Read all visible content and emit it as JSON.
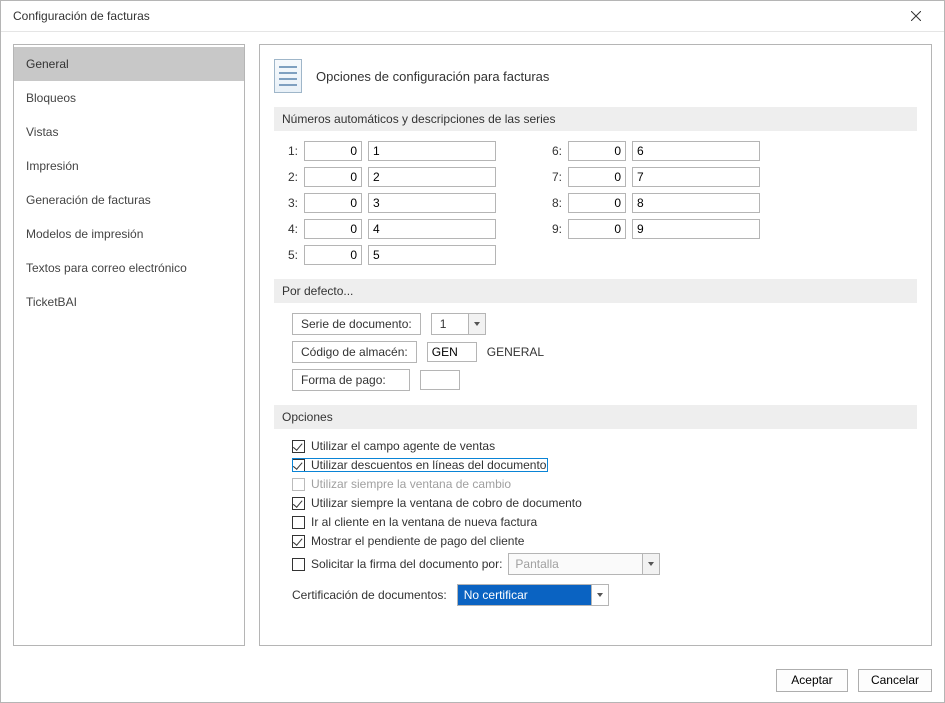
{
  "window": {
    "title": "Configuración de facturas"
  },
  "sidebar": {
    "items": [
      {
        "label": "General",
        "active": true
      },
      {
        "label": "Bloqueos"
      },
      {
        "label": "Vistas"
      },
      {
        "label": "Impresión"
      },
      {
        "label": "Generación de facturas"
      },
      {
        "label": "Modelos de impresión"
      },
      {
        "label": "Textos para correo electrónico"
      },
      {
        "label": "TicketBAI"
      }
    ]
  },
  "header": {
    "title": "Opciones de configuración para facturas"
  },
  "sections": {
    "series_header": "Números automáticos y descripciones de las series",
    "defaults_header": "Por defecto...",
    "options_header": "Opciones"
  },
  "series": [
    {
      "idx": "1:",
      "num": "0",
      "desc": "1"
    },
    {
      "idx": "2:",
      "num": "0",
      "desc": "2"
    },
    {
      "idx": "3:",
      "num": "0",
      "desc": "3"
    },
    {
      "idx": "4:",
      "num": "0",
      "desc": "4"
    },
    {
      "idx": "5:",
      "num": "0",
      "desc": "5"
    },
    {
      "idx": "6:",
      "num": "0",
      "desc": "6"
    },
    {
      "idx": "7:",
      "num": "0",
      "desc": "7"
    },
    {
      "idx": "8:",
      "num": "0",
      "desc": "8"
    },
    {
      "idx": "9:",
      "num": "0",
      "desc": "9"
    }
  ],
  "defaults": {
    "serie_label": "Serie de documento:",
    "serie_value": "1",
    "almacen_label": "Código de almacén:",
    "almacen_value": "GEN",
    "almacen_desc": "GENERAL",
    "forma_pago_label": "Forma de pago:",
    "forma_pago_value": ""
  },
  "options": {
    "o1": "Utilizar el campo agente de ventas",
    "o2": "Utilizar descuentos en líneas del documento",
    "o3": "Utilizar siempre la ventana de cambio",
    "o4": "Utilizar siempre la ventana de cobro de documento",
    "o5": "Ir al cliente en la ventana de nueva factura",
    "o6": "Mostrar el pendiente de pago del cliente",
    "o7": "Solicitar la firma del documento por:",
    "sign_combo": "Pantalla",
    "cert_label": "Certificación de documentos:",
    "cert_value": "No certificar"
  },
  "footer": {
    "ok": "Aceptar",
    "cancel": "Cancelar"
  }
}
